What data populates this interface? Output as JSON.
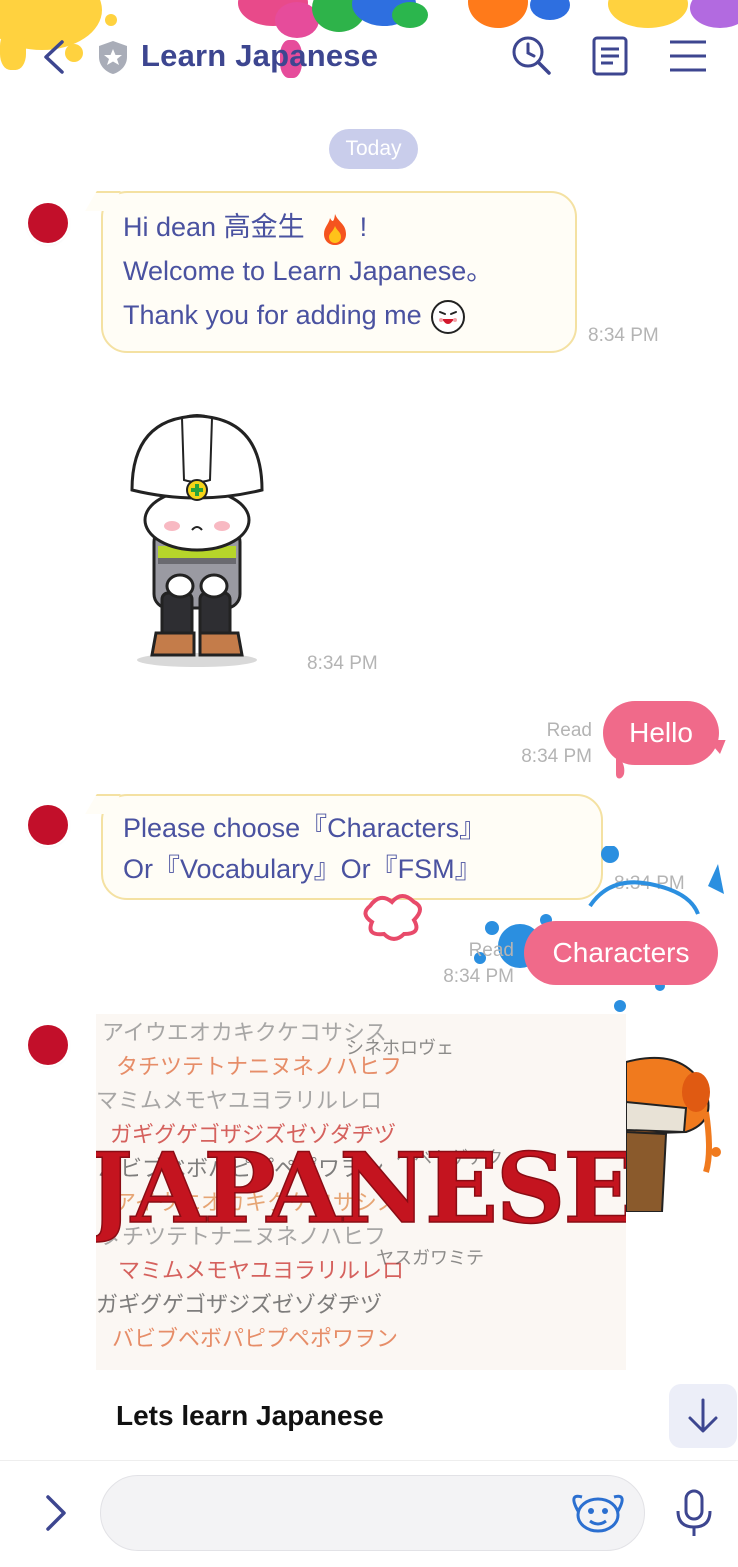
{
  "header": {
    "title": "Learn Japanese",
    "back_icon": "chevron-left-icon",
    "official_icon": "shield-star-icon",
    "search_icon": "clock-search-icon",
    "notes_icon": "note-icon",
    "menu_icon": "hamburger-icon"
  },
  "chat": {
    "date_separator": "Today",
    "messages": [
      {
        "sender": "bot",
        "lines": [
          "Hi dean 高金生",
          "!",
          "Welcome to Learn Japanese。",
          "Thank you for adding me"
        ],
        "time": "8:34 PM"
      },
      {
        "sender": "bot",
        "type": "sticker",
        "sticker": "bowing-construction-worker",
        "time": "8:34 PM"
      },
      {
        "sender": "me",
        "text": "Hello",
        "read": "Read",
        "time": "8:34 PM"
      },
      {
        "sender": "bot",
        "lines": [
          "Please choose『Characters』",
          "Or『Vocabulary』Or『FSM』"
        ],
        "time": "8:34 PM"
      },
      {
        "sender": "me",
        "text": "Characters",
        "read": "Read",
        "time": "8:34 PM"
      },
      {
        "sender": "bot",
        "type": "image-card",
        "image_word": "JAPANESE",
        "card_title": "Lets learn Japanese"
      }
    ]
  },
  "footer": {
    "expand_icon": "chevron-right-icon",
    "input_placeholder": "",
    "emoji_icon": "sticker-face-icon",
    "mic_icon": "microphone-icon"
  },
  "colors": {
    "accent": "#3d4690",
    "incoming_bubble_border": "#f4e1a2",
    "outgoing_bubble": "#f06a8a",
    "avatar": "#c20f2a"
  }
}
